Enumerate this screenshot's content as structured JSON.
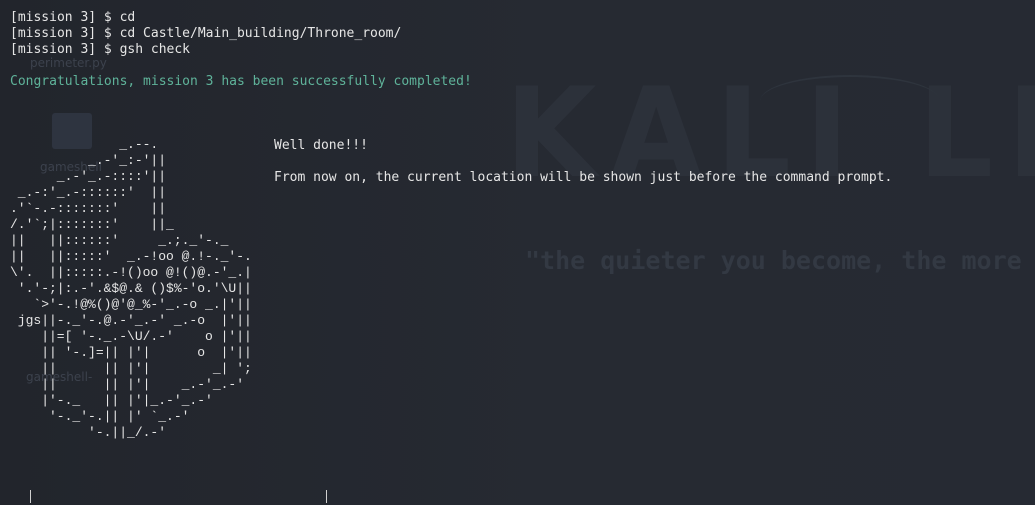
{
  "terminal": {
    "lines": [
      "[mission 3] $ cd",
      "[mission 3] $ cd Castle/Main_building/Throne_room/",
      "[mission 3] $ gsh check"
    ],
    "success_message": "Congratulations, mission 3 has been successfully completed!"
  },
  "ascii_art": "              _.--.\n          _.-'_:-'||\n      _.-'_.-::::'||\n _.-:'_.-::::::'  ||\n.'`-.-:::::::'    ||\n/.'`;|:::::::'    ||_\n||   ||::::::'     _.;._'-._\n||   ||:::::'  _.-!oo @.!-._'-.\n\\'.  ||:::::.-!()oo @!()@.-'_.|\n '.'-;|:.-'.&$@.& ()$%-'o.'\\U||\n   `>'-.!@%()@'@_%-'_.-o _.|'||\n jgs||-._'-.@.-'_.-' _.-o  |'||\n    ||=[ '-._.-\\U/.-'    o |'||\n    || '-.]=|| |'|      o  |'||\n    ||      || |'|        _| ';\n    ||      || |'|    _.-'_.-'\n    |'-._   || |'|_.-'_.-'\n     '-._'-.|| |' `_.-'\n          '-.||_/.-'",
  "message": {
    "title": "Well done!!!",
    "body": "From now on, the current location will be shown just before the command prompt."
  },
  "wallpaper": {
    "logo_text": "KALI LI",
    "slogan": "\"the quieter you become, the more",
    "desktop_labels": [
      "perimeter.py",
      "gameshell",
      "gameshell-"
    ]
  },
  "colors": {
    "background": "#23262e",
    "text": "#e6e6e6",
    "success": "#5fb39a"
  }
}
